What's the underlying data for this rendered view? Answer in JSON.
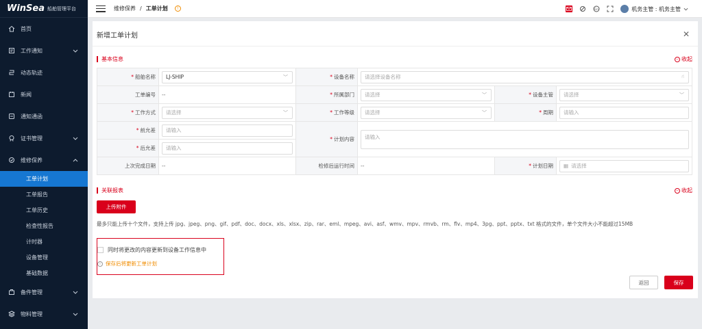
{
  "app": {
    "logo": "WinSea",
    "subtitle": "船舶管理平台"
  },
  "sidebar": {
    "items": [
      {
        "label": "首页",
        "icon": "home-icon"
      },
      {
        "label": "工作通知",
        "icon": "notice-icon",
        "expandable": true
      },
      {
        "label": "动态轨迹",
        "icon": "track-icon"
      },
      {
        "label": "新闻",
        "icon": "news-icon"
      },
      {
        "label": "通知通函",
        "icon": "circular-icon"
      },
      {
        "label": "证书管理",
        "icon": "certificate-icon",
        "expandable": true
      },
      {
        "label": "维修保养",
        "icon": "maintenance-icon",
        "expandable": true,
        "expanded": true
      }
    ],
    "sub_items": [
      {
        "label": "工单计划",
        "active": true
      },
      {
        "label": "工单报告"
      },
      {
        "label": "工单历史"
      },
      {
        "label": "检查性报告"
      },
      {
        "label": "计时器"
      },
      {
        "label": "设备管理"
      },
      {
        "label": "基础数据"
      }
    ],
    "bottom_items": [
      {
        "label": "备件管理",
        "icon": "spare-parts-icon"
      },
      {
        "label": "物料管理",
        "icon": "material-icon"
      }
    ]
  },
  "topbar": {
    "breadcrumb_parent": "维修保养",
    "breadcrumb_sep": "/",
    "breadcrumb_current": "工单计划",
    "user": "机务主管 : 机务主管"
  },
  "modal": {
    "title": "新增工单计划",
    "section_basic": "基本信息",
    "section_reports": "关联报表",
    "collapse_label": "收起",
    "fields": {
      "ship_name": {
        "label": "船舶名称",
        "value": "LJ-SHIP"
      },
      "equipment_name": {
        "label": "设备名称",
        "placeholder": "请选择设备名称"
      },
      "order_no": {
        "label": "工单编号",
        "value": "--"
      },
      "department": {
        "label": "所属部门",
        "placeholder": "请选择"
      },
      "equipment_manager": {
        "label": "设备主管",
        "placeholder": "请选择"
      },
      "work_mode": {
        "label": "工作方式",
        "placeholder": "请选择"
      },
      "work_level": {
        "label": "工作等级",
        "placeholder": "请选择"
      },
      "cycle": {
        "label": "周期",
        "placeholder": "请输入"
      },
      "pre_tolerance": {
        "label": "前允差",
        "placeholder": "请输入"
      },
      "post_tolerance": {
        "label": "后允差",
        "placeholder": "请输入"
      },
      "plan_content": {
        "label": "计划内容",
        "placeholder": "请输入"
      },
      "last_completed": {
        "label": "上次完成日期",
        "value": "--"
      },
      "runtime_after": {
        "label": "检修后运行时间",
        "value": "--"
      },
      "plan_date": {
        "label": "计划日期",
        "placeholder": "请选择"
      }
    },
    "upload_label": "上传附件",
    "upload_hint": "最多只能上传十个文件，支持上传 jpg、jpeg、png、gif、pdf、doc、docx、xls、xlsx、zip、rar、eml、mpeg、avi、asf、wmv、mpv、rmvb、rm、flv、mp4、3pg、ppt、pptx、txt 格式的文件，单个文件大小不能超过15MB",
    "sync_checkbox_label": "同时将更改的内容更新到设备工作信息中",
    "save_tip": "保存后将更新工单计划",
    "back_label": "返回",
    "save_label": "保存"
  },
  "colors": {
    "accent": "#d9001b",
    "sidebar_bg": "#0d1b2e",
    "active_nav": "#1677d2",
    "warning": "#f08c00"
  }
}
